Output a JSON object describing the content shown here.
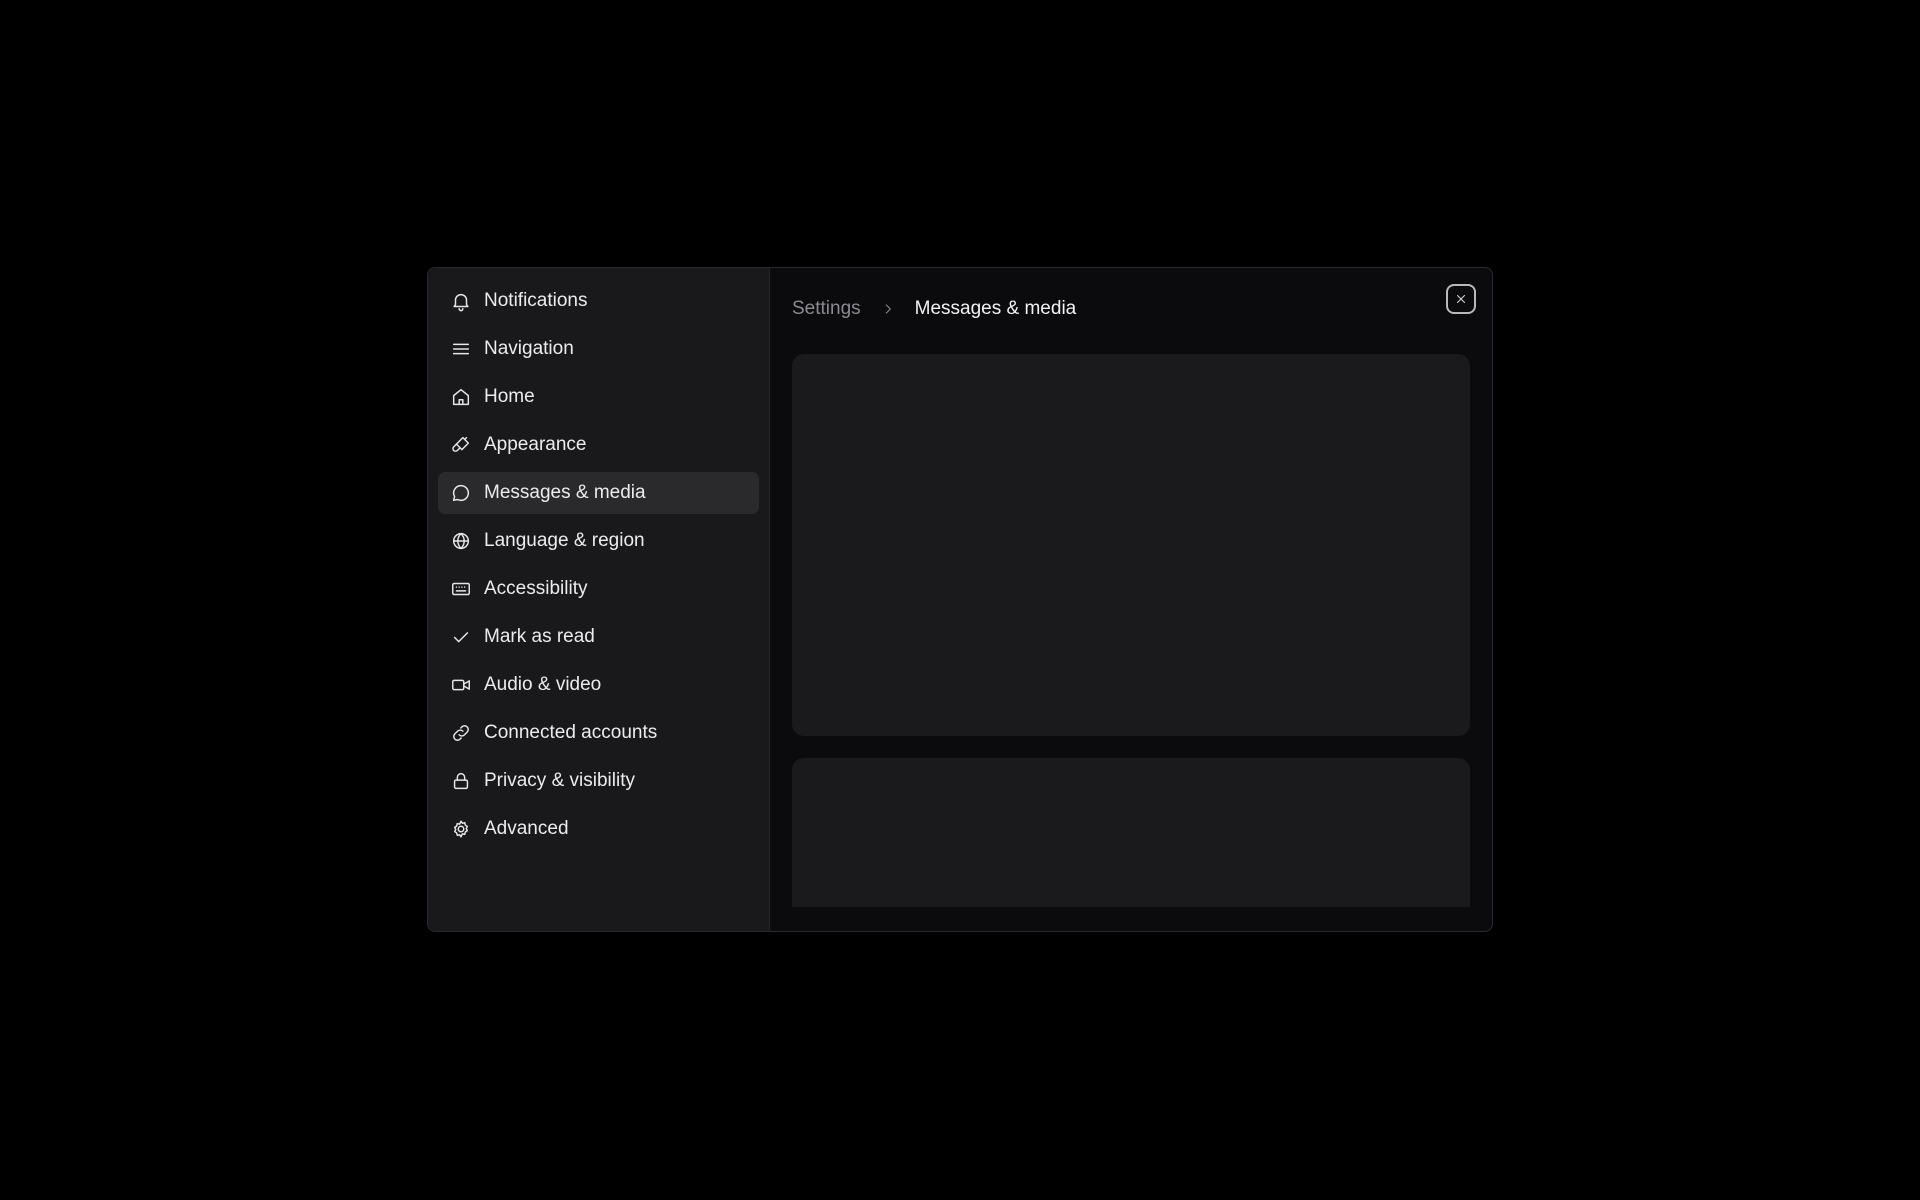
{
  "breadcrumb": {
    "root": "Settings",
    "current": "Messages & media"
  },
  "sidebar": {
    "items": [
      {
        "label": "Notifications",
        "icon": "bell-icon"
      },
      {
        "label": "Navigation",
        "icon": "menu-icon"
      },
      {
        "label": "Home",
        "icon": "home-icon"
      },
      {
        "label": "Appearance",
        "icon": "paintbrush-icon"
      },
      {
        "label": "Messages & media",
        "icon": "message-icon",
        "active": true
      },
      {
        "label": "Language & region",
        "icon": "globe-icon"
      },
      {
        "label": "Accessibility",
        "icon": "keyboard-icon"
      },
      {
        "label": "Mark as read",
        "icon": "check-icon"
      },
      {
        "label": "Audio & video",
        "icon": "video-icon"
      },
      {
        "label": "Connected accounts",
        "icon": "link-icon"
      },
      {
        "label": "Privacy & visibility",
        "icon": "lock-icon"
      },
      {
        "label": "Advanced",
        "icon": "gear-icon"
      }
    ]
  },
  "colors": {
    "background": "#000000",
    "sidebar": "#19191b",
    "main": "#0b0b0d",
    "card": "#1a1a1d",
    "active_item": "#2a2a2d"
  }
}
